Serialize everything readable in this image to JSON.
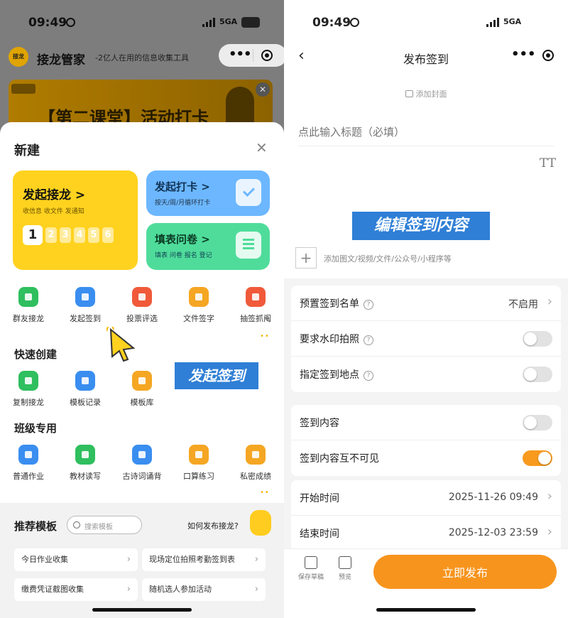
{
  "status": {
    "time": "09:49",
    "network": "5GA",
    "battery": "100"
  },
  "left": {
    "app_logo": "接龙",
    "app_name": "接龙管家",
    "app_tagline": "-2亿人在用的信息收集工具",
    "banner_text": "【第二课堂】活动打卡",
    "sheet_title": "新建",
    "cards": {
      "main": {
        "title": "发起接龙 >",
        "subtitle": "收信息 收文件 发通知",
        "steps": [
          "1",
          "2",
          "3",
          "4",
          "5",
          "6"
        ]
      },
      "clock": {
        "title": "发起打卡 >",
        "subtitle": "按天/周/月循环打卡"
      },
      "survey": {
        "title": "填表问卷 >",
        "subtitle": "填表 问卷 报名 登记"
      }
    },
    "row1": [
      {
        "label": "群友接龙",
        "color": "#2fbf5f"
      },
      {
        "label": "发起签到",
        "color": "#3a8ef0"
      },
      {
        "label": "投票评选",
        "color": "#f05a3a"
      },
      {
        "label": "文件签字",
        "color": "#f5a623"
      },
      {
        "label": "抽签抓阄",
        "color": "#f05a3a"
      }
    ],
    "quick_title": "快速创建",
    "quick": [
      {
        "label": "复制接龙",
        "color": "#2fbf5f"
      },
      {
        "label": "模板记录",
        "color": "#3a8ef0"
      },
      {
        "label": "模板库",
        "color": "#f5a623"
      }
    ],
    "class_title": "班级专用",
    "class_items": [
      {
        "label": "普通作业",
        "color": "#3a8ef0"
      },
      {
        "label": "教材读写",
        "color": "#2fbf5f"
      },
      {
        "label": "古诗词诵背",
        "color": "#3a8ef0"
      },
      {
        "label": "口算练习",
        "color": "#f5a623"
      },
      {
        "label": "私密成绩",
        "color": "#f5a623"
      }
    ],
    "callout": "发起签到",
    "templates": {
      "title": "推荐模板",
      "search_placeholder": "搜索模板",
      "help": "如何发布接龙?",
      "items": [
        "今日作业收集",
        "现场定位拍照考勤签到表",
        "缴费凭证截图收集",
        "随机选人参加活动"
      ]
    }
  },
  "right": {
    "nav_title": "发布签到",
    "cover": "添加封面",
    "title_placeholder": "点此输入标题（必填）",
    "format_icon": "TT",
    "callout": "编辑签到内容",
    "attach_hint": "添加图文/视频/文件/公众号/小程序等",
    "group1": [
      {
        "label": "预置签到名单",
        "value": "不启用"
      },
      {
        "label": "要求水印拍照",
        "on": false
      },
      {
        "label": "指定签到地点",
        "on": false
      }
    ],
    "group2": [
      {
        "label": "签到内容",
        "on": false
      },
      {
        "label": "签到内容互不可见",
        "on": true
      }
    ],
    "group3": [
      {
        "label": "开始时间",
        "value": "2025-11-26 09:49"
      },
      {
        "label": "结束时间",
        "value": "2025-12-03 23:59"
      }
    ],
    "bottom": {
      "save": "保存草稿",
      "preview": "预览",
      "publish": "立即发布"
    }
  },
  "colors": {
    "accent_orange": "#f7941d",
    "brand_yellow": "#ffd21f",
    "callout_blue": "#2f7fd6"
  }
}
